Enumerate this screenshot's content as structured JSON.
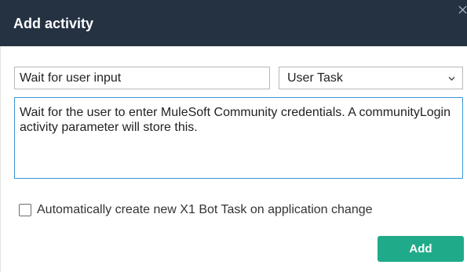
{
  "dialog": {
    "title": "Add activity",
    "close_icon": "close-icon",
    "colors": {
      "header_bg": "#243242",
      "primary_button": "#1fab89",
      "focus_border": "#3c95d2"
    }
  },
  "form": {
    "name_value": "Wait for user input",
    "type_select": {
      "selected": "User Task",
      "icon": "chevron-down-icon"
    },
    "description_value": "Wait for the user to enter MuleSoft Community credentials. A communityLogin activity parameter will store this.",
    "auto_create_checkbox": {
      "checked": false,
      "label": "Automatically create new X1 Bot Task on application change"
    }
  },
  "actions": {
    "add_label": "Add"
  }
}
